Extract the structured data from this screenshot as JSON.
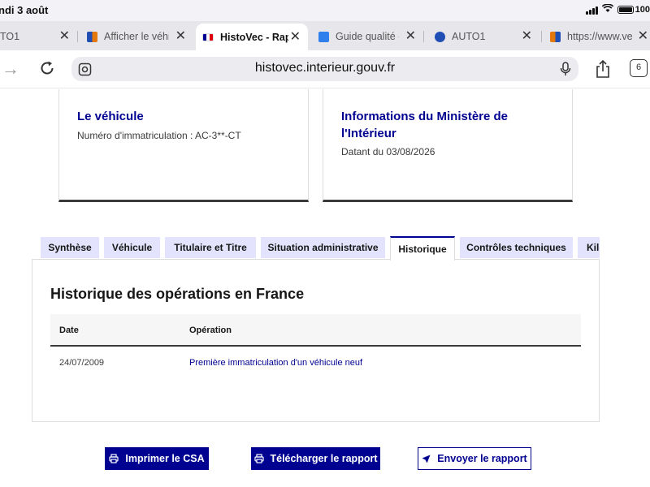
{
  "status": {
    "time": "ndi 3 août",
    "battery": "100"
  },
  "browser": {
    "tabs": [
      {
        "title": "TO1",
        "favicon_color": "#1f4fb5"
      },
      {
        "title": "Afficher le véhi",
        "favicon_color": "#e3780c"
      },
      {
        "title": "HistoVec - Rap",
        "favicon_color": "#000091"
      },
      {
        "title": "Guide qualité -",
        "favicon_color": "#2f80ed"
      },
      {
        "title": "AUTO1",
        "favicon_color": "#1f4fb5"
      },
      {
        "title": "https://www.ve",
        "favicon_color": "#e3780c"
      }
    ],
    "url": "histovec.interieur.gouv.fr",
    "tab_count": "6"
  },
  "cards": {
    "vehicle": {
      "title": "Le véhicule",
      "text": "Numéro d'immatriculation : AC-3**-CT"
    },
    "ministry": {
      "title_line1": "Informations du Ministère de",
      "title_line2": "l'Intérieur",
      "text": "Datant du 03/08/2026"
    }
  },
  "report_tabs": [
    "Synthèse",
    "Véhicule",
    "Titulaire et Titre",
    "Situation administrative",
    "Historique",
    "Contrôles techniques",
    "Kilo"
  ],
  "history": {
    "title": "Historique des opérations en France",
    "columns": [
      "Date",
      "Opération"
    ],
    "rows": [
      {
        "date": "24/07/2009",
        "operation": "Première immatriculation d'un véhicule neuf"
      }
    ]
  },
  "actions": {
    "print": "Imprimer le CSA",
    "download": "Télécharger le rapport",
    "send": "Envoyer le rapport"
  },
  "colors": {
    "accent": "#000091",
    "tab_bg": "#e3e3fd"
  }
}
